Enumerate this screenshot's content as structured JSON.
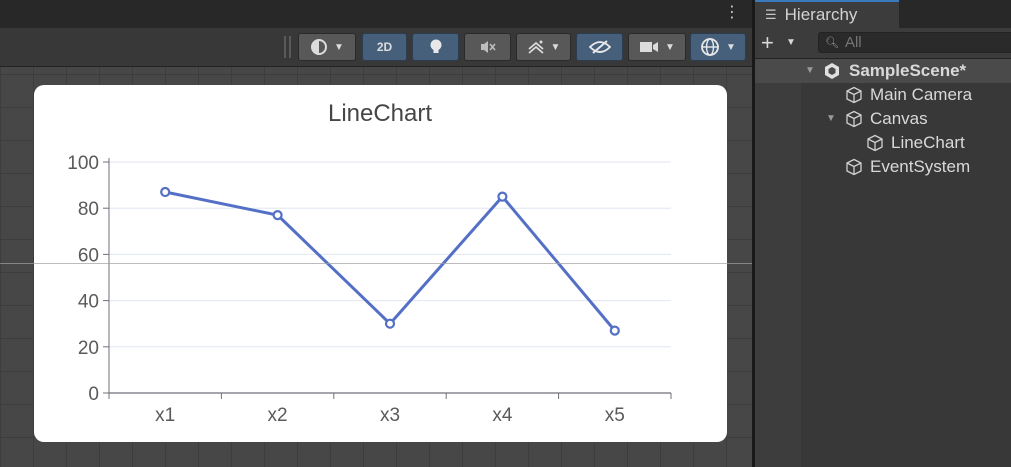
{
  "scene_view": {
    "toolbar": {
      "shading_icon": "draw-mode-icon",
      "mode_2d_label": "2D",
      "lighting_icon": "lightbulb-icon",
      "audio_icon": "audio-mute-icon",
      "effects_icon": "effects-icon",
      "visibility_icon": "eye-hidden-icon",
      "camera_icon": "camera-icon",
      "gizmos_icon": "gizmo-sphere-icon"
    }
  },
  "chart_data": {
    "type": "line",
    "title": "LineChart",
    "categories": [
      "x1",
      "x2",
      "x3",
      "x4",
      "x5"
    ],
    "series": [
      {
        "values": [
          87,
          77,
          30,
          85,
          27
        ],
        "color": "#5470c6"
      }
    ],
    "y_ticks": [
      "0",
      "20",
      "40",
      "60",
      "80",
      "100"
    ],
    "ylim": [
      0,
      100
    ],
    "grid": true,
    "legend": "none"
  },
  "hierarchy": {
    "tab_title": "Hierarchy",
    "search_placeholder": "All",
    "items": [
      {
        "label": "SampleScene*",
        "icon": "unity-scene-icon",
        "bold": true,
        "expanded": true
      },
      {
        "label": "Main Camera",
        "icon": "cube-icon"
      },
      {
        "label": "Canvas",
        "icon": "cube-icon",
        "expanded": true
      },
      {
        "label": "LineChart",
        "icon": "cube-icon"
      },
      {
        "label": "EventSystem",
        "icon": "cube-icon"
      }
    ]
  }
}
